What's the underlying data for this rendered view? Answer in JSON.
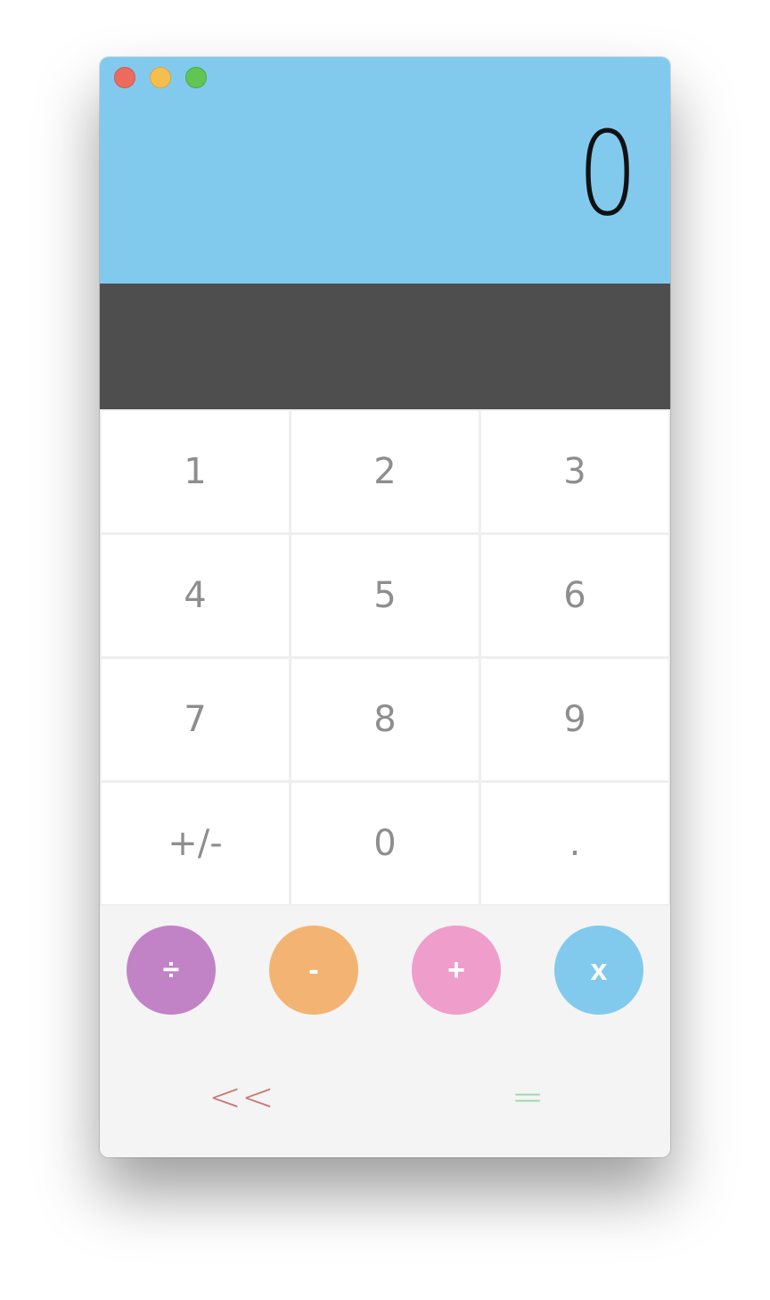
{
  "display": {
    "value": "0",
    "background": "#81caee"
  },
  "history": {
    "background": "#4e4e4e"
  },
  "keypad": {
    "keys": [
      "1",
      "2",
      "3",
      "4",
      "5",
      "6",
      "7",
      "8",
      "9",
      "+/-",
      "0",
      "."
    ]
  },
  "operators": [
    {
      "symbol": "÷",
      "name": "divide",
      "color": "#c282c6"
    },
    {
      "symbol": "-",
      "name": "subtract",
      "color": "#f3b473"
    },
    {
      "symbol": "+",
      "name": "add",
      "color": "#ef9dcb"
    },
    {
      "symbol": "x",
      "name": "multiply",
      "color": "#81caee"
    }
  ],
  "actions": {
    "backspace": {
      "label": "<<",
      "color": "#c9797a"
    },
    "equals": {
      "label": "=",
      "color": "#98d6a5"
    }
  }
}
